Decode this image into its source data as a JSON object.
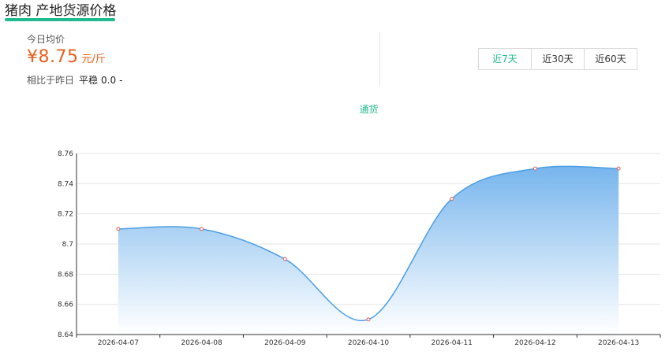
{
  "header": {
    "title": "猪肉 产地货源价格"
  },
  "summary": {
    "today_label": "今日均价",
    "price": "¥8.75",
    "unit": "元/斤",
    "compare_label": "相比于昨日",
    "compare_status": "平稳",
    "compare_value": "0.0",
    "compare_trend": "-"
  },
  "range_tabs": [
    {
      "label": "近7天",
      "active": true
    },
    {
      "label": "近30天",
      "active": false
    },
    {
      "label": "近60天",
      "active": false
    }
  ],
  "colors": {
    "accent": "#1fba8e",
    "price": "#e8601c",
    "line": "#4a9ee6",
    "area_top": "#6fb1ec",
    "point": "#e05a5a"
  },
  "chart_data": {
    "type": "area",
    "smooth": true,
    "x": [
      "2026-04-07",
      "2026-04-08",
      "2026-04-09",
      "2026-04-10",
      "2026-04-11",
      "2026-04-12",
      "2026-04-13"
    ],
    "series": [
      {
        "name": "通货",
        "values": [
          8.71,
          8.71,
          8.69,
          8.65,
          8.73,
          8.75,
          8.75
        ]
      }
    ],
    "ylim": [
      8.64,
      8.76
    ],
    "yticks": [
      8.64,
      8.66,
      8.68,
      8.7,
      8.72,
      8.74,
      8.76
    ],
    "ytick_labels": [
      "8.64",
      "8.66",
      "8.68",
      "8.7",
      "8.72",
      "8.74",
      "8.76"
    ],
    "grid": true,
    "legend": "top-center"
  }
}
